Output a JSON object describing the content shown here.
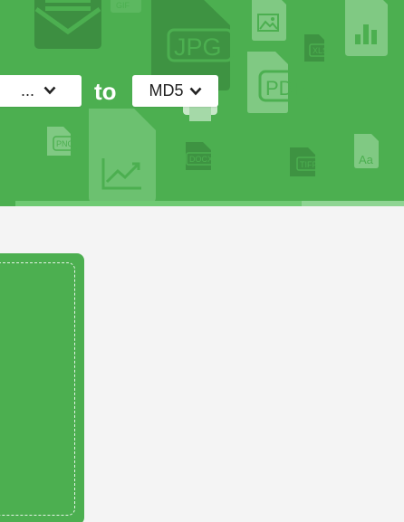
{
  "header": {
    "from_select": {
      "value": "..."
    },
    "to_label": "to",
    "to_select": {
      "value": "MD5"
    },
    "background_icons": {
      "jpg": "JPG",
      "pdf": "PDF",
      "png": "PNG",
      "docx": "DOCX",
      "tiff": "TIFF",
      "xls": "XLS",
      "gif": "GIF",
      "font": "Aa"
    }
  },
  "icons": {
    "chevron": "chevron-down-icon",
    "envelope": "envelope-icon",
    "image": "image-file-icon",
    "chart": "chart-file-icon",
    "printer": "printer-icon"
  },
  "colors": {
    "hero_green": "#4caf50",
    "background": "#f4f4f4",
    "white": "#ffffff"
  }
}
